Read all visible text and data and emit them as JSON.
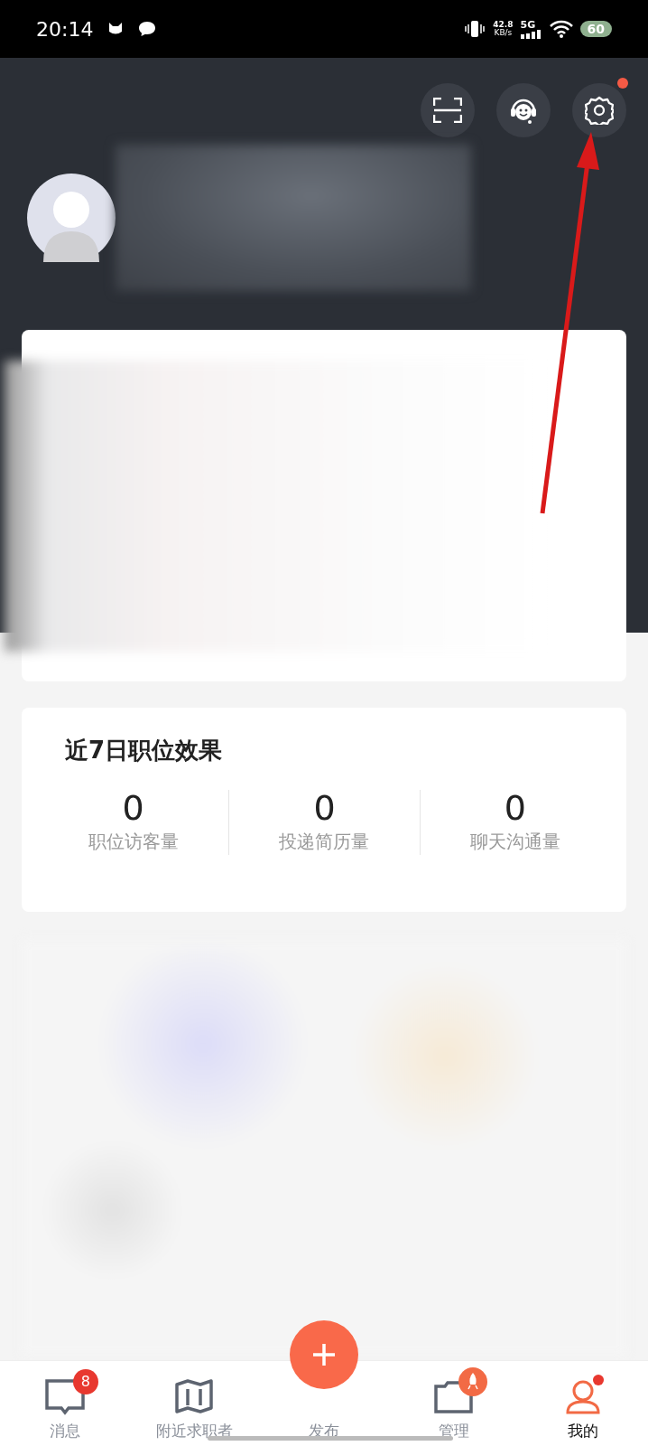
{
  "status_bar": {
    "time": "20:14",
    "net_speed": "42.8",
    "net_unit": "KB/s",
    "network": "5G",
    "battery": "60"
  },
  "header": {
    "settings_notification_dot": true
  },
  "stats_card": {
    "title": "近7日职位效果",
    "stats": [
      {
        "value": "0",
        "label": "职位访客量"
      },
      {
        "value": "0",
        "label": "投递简历量"
      },
      {
        "value": "0",
        "label": "聊天沟通量"
      }
    ]
  },
  "tab_bar": {
    "items": [
      {
        "kind": "message",
        "label": "消息",
        "badge": "8",
        "dot": false,
        "selected": false
      },
      {
        "kind": "map",
        "label": "附近求职者",
        "dot": false,
        "selected": false
      },
      {
        "kind": "publish",
        "label": "发布",
        "dot": false,
        "selected": false
      },
      {
        "kind": "folder",
        "label": "管理",
        "dot": false,
        "selected": false
      },
      {
        "kind": "person",
        "label": "我的",
        "dot": true,
        "selected": true
      }
    ]
  }
}
